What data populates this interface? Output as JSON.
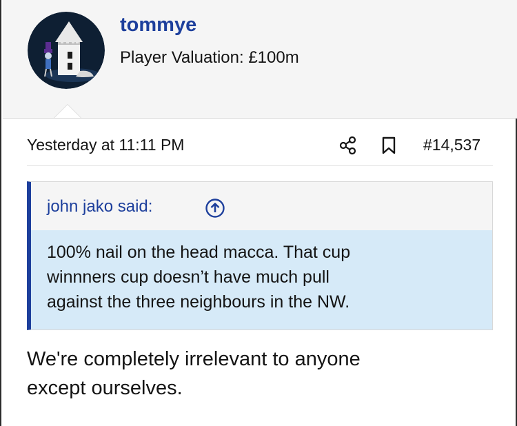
{
  "user": {
    "name": "tommye",
    "title": "Player Valuation: £100m",
    "avatar_icon": "lighthouse-tower-avatar-icon"
  },
  "post": {
    "date": "Yesterday at 11:11 PM",
    "number": "#14,537",
    "share_icon": "share-icon",
    "bookmark_icon": "bookmark-icon"
  },
  "quote": {
    "author": "john jako said:",
    "jump_icon": "arrow-up-circle-icon",
    "lines": [
      "100% nail on the head macca. That cup",
      "winnners cup doesn’t have much pull",
      "against the three neighbours in the NW."
    ]
  },
  "reply": {
    "lines": [
      "We're completely irrelevant to anyone",
      "except ourselves."
    ]
  },
  "colors": {
    "accent": "#1d3f9c",
    "quote_background": "#d6eaf8",
    "header_background": "#f5f5f5"
  }
}
